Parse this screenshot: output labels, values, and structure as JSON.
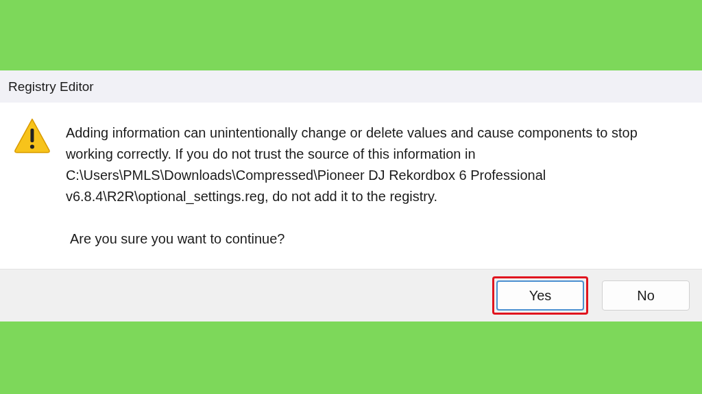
{
  "window": {
    "title": "Registry Editor"
  },
  "message": "Adding information can unintentionally change or delete values and cause components to stop working correctly. If you do not trust the source of this information in C:\\Users\\PMLS\\Downloads\\Compressed\\Pioneer DJ Rekordbox 6 Professional v6.8.4\\R2R\\optional_settings.reg, do not add it to the registry.",
  "question": "Are you sure you want to continue?",
  "buttons": [
    {
      "label": "Yes",
      "selected": true,
      "highlighted": true
    },
    {
      "label": "No",
      "selected": false,
      "highlighted": false
    }
  ]
}
